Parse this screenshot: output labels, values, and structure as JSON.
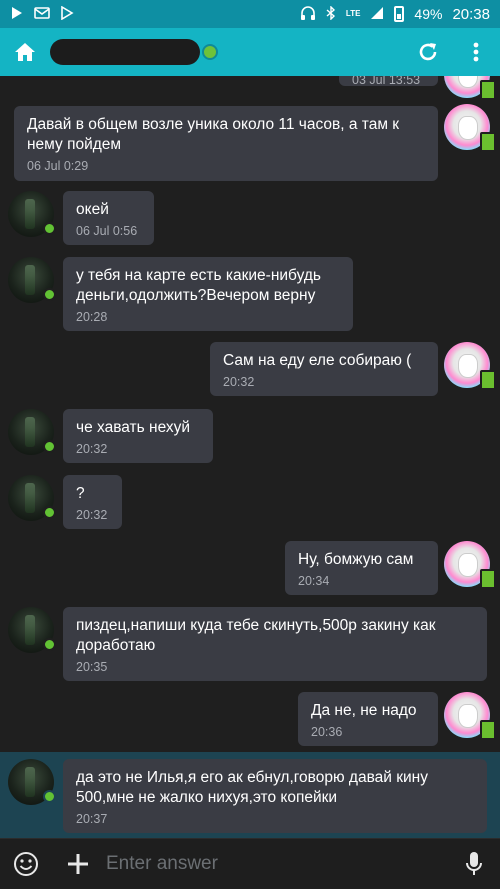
{
  "status_bar": {
    "battery": "49%",
    "time": "20:38",
    "network": "LTE"
  },
  "header": {
    "contact_name": "",
    "contact_status": "online"
  },
  "messages": [
    {
      "side": "self",
      "text": "",
      "time": "03 Jul 13:53"
    },
    {
      "side": "self",
      "text": "Давай в общем возле уника около 11 часов, а там к нему пойдем",
      "time": "06 Jul 0:29"
    },
    {
      "side": "other",
      "text": "окей",
      "time": "06 Jul 0:56"
    },
    {
      "side": "other",
      "text": "у тебя на карте есть какие-нибудь деньги,одолжить?Вечером верну",
      "time": "20:28"
    },
    {
      "side": "self",
      "text": "Сам на еду еле собираю (",
      "time": "20:32"
    },
    {
      "side": "other",
      "text": "че хавать нехуй",
      "time": "20:32"
    },
    {
      "side": "other",
      "text": "?",
      "time": "20:32"
    },
    {
      "side": "self",
      "text": "Ну, бомжую сам",
      "time": "20:34"
    },
    {
      "side": "other",
      "text": "пиздец,напиши куда тебе скинуть,500р закину как доработаю",
      "time": "20:35"
    },
    {
      "side": "self",
      "text": "Да не, не надо",
      "time": "20:36"
    },
    {
      "side": "other",
      "text": "да это не Илья,я его ак ебнул,говорю давай кину 500,мне не жалко нихуя,это копейки",
      "time": "20:37"
    }
  ],
  "input": {
    "placeholder": "Enter answer"
  },
  "colors": {
    "accent": "#14b4c4",
    "status_bar": "#0e8fa3",
    "bubble": "#3a3c44",
    "background": "#1f1f1f",
    "online": "#62c234",
    "highlight": "#1d4452"
  },
  "icons": [
    "play-icon",
    "email-icon",
    "play-store-icon",
    "headset-icon",
    "bluetooth-icon",
    "lte-icon",
    "signal-icon",
    "battery-icon",
    "home-icon",
    "refresh-icon",
    "more-vert-icon",
    "emoji-icon",
    "plus-icon",
    "mic-icon"
  ]
}
